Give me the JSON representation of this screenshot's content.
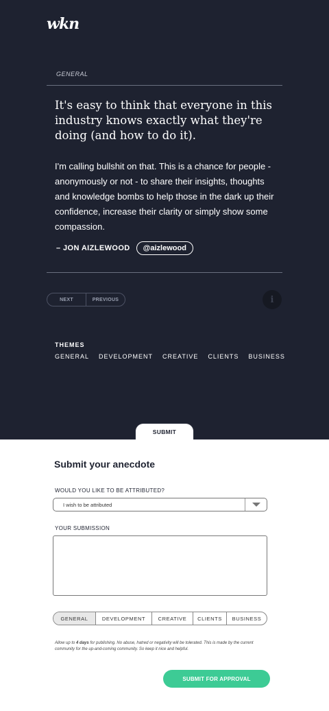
{
  "brand": {
    "logo_text": "wkn"
  },
  "post": {
    "category": "GENERAL",
    "title": "It's easy to think that everyone in this industry knows exactly what they're doing (and how to do it).",
    "body": "I'm calling bullshit on that. This is a chance for people - anonymously or not - to share their insights, thoughts and knowledge bombs to help those in the dark up their confidence, increase their clarity or simply show some compassion.",
    "author": "– JON AIZLEWOOD",
    "handle": "@aizlewood"
  },
  "nav": {
    "next_label": "NEXT",
    "previous_label": "PREVIOUS",
    "info_icon": "info-icon"
  },
  "themes": {
    "title": "THEMES",
    "items": [
      "GENERAL",
      "DEVELOPMENT",
      "CREATIVE",
      "CLIENTS",
      "BUSINESS"
    ]
  },
  "submit_tab": {
    "label": "SUBMIT"
  },
  "form": {
    "title": "Submit your anecdote",
    "attribution_label": "WOULD YOU LIKE TO BE ATTRIBUTED?",
    "attribution_value": "I wish to be attributed",
    "submission_label": "YOUR SUBMISSION",
    "submission_value": "",
    "theme_tabs": [
      "GENERAL",
      "DEVELOPMENT",
      "CREATIVE",
      "CLIENTS",
      "BUSINESS"
    ],
    "selected_theme": "GENERAL",
    "note_prefix": "Allow up to ",
    "note_bold": "4 days",
    "note_suffix": " for publishing.  No abuse, hatred or negativity will be tolerated.  This is made by the current community for the up-and-coming community. So keep it nice and helpful.",
    "submit_label": "SUBMIT FOR APPROVAL"
  },
  "colors": {
    "dark_bg": "#1e2230",
    "accent": "#3dcb95"
  }
}
